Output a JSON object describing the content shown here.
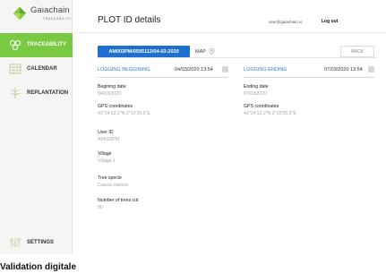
{
  "brand": {
    "name": "Gaiachain",
    "tagline": "TRACEABILITY",
    "color": "#7ac943"
  },
  "sidebar": {
    "items": [
      {
        "label": "TRACEABILITY",
        "icon": "traceability-icon",
        "active": true
      },
      {
        "label": "CALENDAR",
        "icon": "calendar-icon",
        "active": false
      },
      {
        "label": "REPLANTATION",
        "icon": "tree-icon",
        "active": false
      }
    ],
    "settings": {
      "label": "SETTINGS",
      "icon": "settings-icon"
    }
  },
  "header": {
    "title": "PLOT ID details",
    "user_email": "user@gaiachain.io",
    "logout_label": "Log out"
  },
  "tabs": {
    "active_label": "AM003PM/0595112/04-03-2020",
    "map_label": "MAP",
    "back_label": "BACK"
  },
  "logging_begin": {
    "title": "LOGGING BEGGINING",
    "datetime": "04/03/2020 13:54",
    "fields": [
      {
        "label": "Begining date",
        "value": "04/03/2020"
      },
      {
        "label": "GPS coordinates",
        "value": "41°24'12.2\"N 2°10'26.5\"E"
      },
      {
        "label": "User ID",
        "value": "AM003PM"
      },
      {
        "label": "Village",
        "value": "Village 1"
      },
      {
        "label": "Tree specie",
        "value": "Cassia siamea"
      },
      {
        "label": "Number of trees cut",
        "value": "90"
      }
    ]
  },
  "logging_end": {
    "title": "LOGGING ENDING",
    "datetime": "07/03/2020 13:54",
    "fields": [
      {
        "label": "Ending date",
        "value": "07/03/2020"
      },
      {
        "label": "GPS coordinates",
        "value": "41°24'12.2\"N 2°10'26.5\"E"
      }
    ]
  },
  "footer_caption": "Validation digitale",
  "colors": {
    "accent_blue": "#1f6fd0",
    "link_blue": "#2e7bd6",
    "green": "#7ac943"
  }
}
